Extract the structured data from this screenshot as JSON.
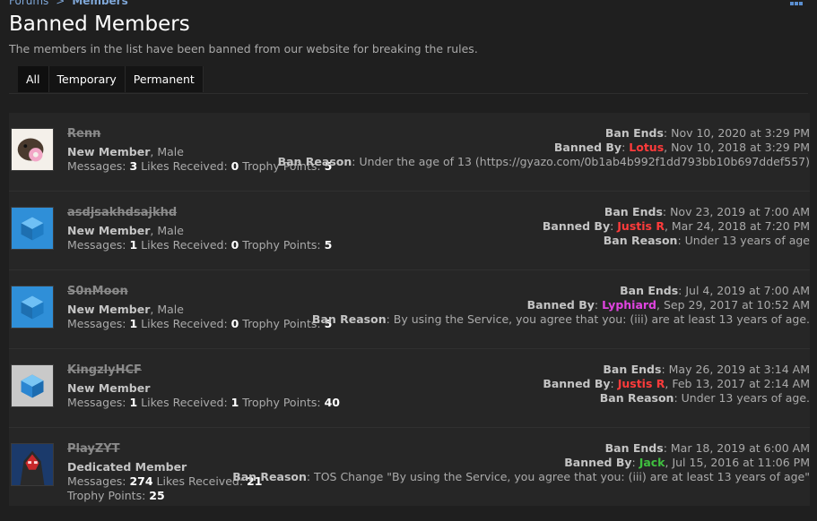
{
  "breadcrumb": {
    "items": [
      "Forums",
      "Members"
    ],
    "separator": ">"
  },
  "page": {
    "title": "Banned Members",
    "description": "The members in the list have been banned from our website for breaking the rules."
  },
  "tabs": [
    {
      "label": "All",
      "active": true
    },
    {
      "label": "Temporary",
      "active": false
    },
    {
      "label": "Permanent",
      "active": false
    }
  ],
  "labels": {
    "ban_ends": "Ban Ends",
    "banned_by": "Banned By",
    "ban_reason": "Ban Reason",
    "messages": "Messages",
    "likes_received": "Likes Received",
    "trophy_points": "Trophy Points"
  },
  "members": [
    {
      "username": "Renn",
      "rank": "New Member",
      "gender": "Male",
      "messages": "3",
      "likes": "0",
      "trophy": "5",
      "avatar": "photo-avatar",
      "ban_ends": "Nov 10, 2020 at 3:29 PM",
      "banned_by": "Lotus",
      "banned_by_color": "#ff3b3b",
      "banned_on": "Nov 10, 2018 at 3:29 PM",
      "reason": "Under the age of 13 (https://gyazo.com/0b1ab4b992f1dd793bb10b697ddef557)"
    },
    {
      "username": "asdjsakhdsajkhd",
      "rank": "New Member",
      "gender": "Male",
      "messages": "1",
      "likes": "0",
      "trophy": "5",
      "avatar": "blue-cube-avatar",
      "ban_ends": "Nov 23, 2019 at 7:00 AM",
      "banned_by": "Justis R",
      "banned_by_color": "#ff3b3b",
      "banned_on": "Mar 24, 2018 at 7:20 PM",
      "reason": "Under 13 years of age"
    },
    {
      "username": "S0nMoon",
      "rank": "New Member",
      "gender": "Male",
      "messages": "1",
      "likes": "0",
      "trophy": "5",
      "avatar": "blue-cube-avatar",
      "ban_ends": "Jul 4, 2019 at 7:00 AM",
      "banned_by": "Lyphiard",
      "banned_by_color": "#e044e0",
      "banned_on": "Sep 29, 2017 at 10:52 AM",
      "reason": "By using the Service, you agree that you: (iii) are at least 13 years of age."
    },
    {
      "username": "KingzlyHCF",
      "rank": "New Member",
      "gender": "",
      "messages": "1",
      "likes": "1",
      "trophy": "40",
      "avatar": "grey-cube-avatar",
      "ban_ends": "May 26, 2019 at 3:14 AM",
      "banned_by": "Justis R",
      "banned_by_color": "#ff3b3b",
      "banned_on": "Feb 13, 2017 at 2:14 AM",
      "reason": "Under 13 years of age."
    },
    {
      "username": "PlayZYT",
      "rank": "Dedicated Member",
      "gender": "",
      "messages": "274",
      "likes": "21",
      "trophy": "25",
      "avatar": "red-character-avatar",
      "ban_ends": "Mar 18, 2019 at 6:00 AM",
      "banned_by": "Jack",
      "banned_by_color": "#3fbf3f",
      "banned_on": "Jul 15, 2016 at 11:06 PM",
      "reason": "TOS Change \"By using the Service, you agree that you: (iii) are at least 13 years of age\""
    }
  ]
}
